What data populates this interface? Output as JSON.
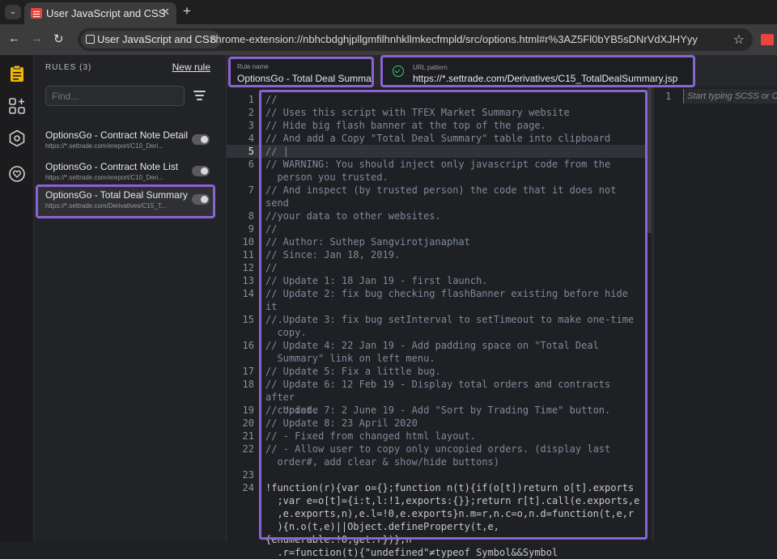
{
  "browser": {
    "tab_title": "User JavaScript and CSS",
    "tab_close_glyph": "✕",
    "new_tab_glyph": "+",
    "site_chip": "User JavaScript and CSS",
    "url": "chrome-extension://nbhcbdghjpllgmfilhnhkllmkecfmpld/src/options.html#r%3AZ5Fl0bYB5sDNrVdXJHYyy",
    "back_glyph": "←",
    "forward_glyph": "→",
    "reload_glyph": "↻",
    "star_glyph": "☆",
    "menu_glyph": "⌄"
  },
  "rules": {
    "title": "RULES (3)",
    "new_rule": "New rule",
    "search_placeholder": "Find...",
    "items": [
      {
        "name": "OptionsGo - Contract Note Detail",
        "url": "https://*.settrade.com/ereport/C10_Deri..."
      },
      {
        "name": "OptionsGo - Contract Note List",
        "url": "https://*.settrade.com/ereport/C10_Deri..."
      },
      {
        "name": "OptionsGo - Total Deal Summary",
        "url": "https://*.settrade.com/Derivatives/C15_T..."
      }
    ]
  },
  "editor": {
    "rule_name_label": "Rule name",
    "rule_name_value": "OptionsGo - Total Deal Summar",
    "url_pattern_label": "URL pattern",
    "url_pattern_value": "https://*.settrade.com/Derivatives/C15_TotalDealSummary.jsp",
    "lines": [
      {
        "n": "1",
        "t": "//"
      },
      {
        "n": "2",
        "t": "// Uses this script with TFEX Market Summary website"
      },
      {
        "n": "3",
        "t": "// Hide big flash banner at the top of the page."
      },
      {
        "n": "4",
        "t": "// And add a Copy \"Total Deal Summary\" table into clipboard"
      },
      {
        "n": "5",
        "t": "// |"
      },
      {
        "n": "6",
        "t": "// WARNING: You should inject only javascript code from the\n  person you trusted."
      },
      {
        "n": "7",
        "t": "// And inspect (by trusted person) the code that it does not send\n  your data to other websites."
      },
      {
        "n": "8",
        "t": "//"
      },
      {
        "n": "9",
        "t": "//"
      },
      {
        "n": "10",
        "t": "// Author: Suthep Sangvirotjanaphat"
      },
      {
        "n": "11",
        "t": "// Since: Jan 18, 2019."
      },
      {
        "n": "12",
        "t": "//"
      },
      {
        "n": "13",
        "t": "// Update 1: 18 Jan 19 - first launch."
      },
      {
        "n": "14",
        "t": "// Update 2: fix bug checking flashBanner existing before hide it\n  ."
      },
      {
        "n": "15",
        "t": "// Update 3: fix bug setInterval to setTimeout to make one-time\n  copy."
      },
      {
        "n": "16",
        "t": "// Update 4: 22 Jan 19 - Add padding space on \"Total Deal\n  Summary\" link on left menu."
      },
      {
        "n": "17",
        "t": "// Update 5: Fix a little bug."
      },
      {
        "n": "18",
        "t": "// Update 6: 12 Feb 19 - Display total orders and contracts after\n  copied."
      },
      {
        "n": "19",
        "t": "// Update 7: 2 June 19 - Add \"Sort by Trading Time\" button."
      },
      {
        "n": "20",
        "t": "// Update 8: 23 April 2020"
      },
      {
        "n": "21",
        "t": "// - Fixed from changed html layout."
      },
      {
        "n": "22",
        "t": "// - Allow user to copy only uncopied orders. (display last\n  order#, add clear & show/hide buttons)"
      },
      {
        "n": "23",
        "t": ""
      }
    ],
    "code_line_number": "24",
    "code_text": "!function(r){var o={};function n(t){if(o[t])return o[t].exports\n  ;var e=o[t]={i:t,l:!1,exports:{}};return r[t].call(e.exports,e\n  ,e.exports,n),e.l=!0,e.exports}n.m=r,n.c=o,n.d=function(t,e,r\n  ){n.o(t,e)||Object.defineProperty(t,e,{enumerable:!0,get:r})},n\n  .r=function(t){\"undefined\"≠typeof Symbol&&Symbol",
    "css_line_number": "1",
    "css_placeholder": "Start typing SCSS or CSS"
  },
  "colors": {
    "accent": "#8a63d2",
    "rail_icon": "#f2b705",
    "valid": "#3ec96b"
  }
}
